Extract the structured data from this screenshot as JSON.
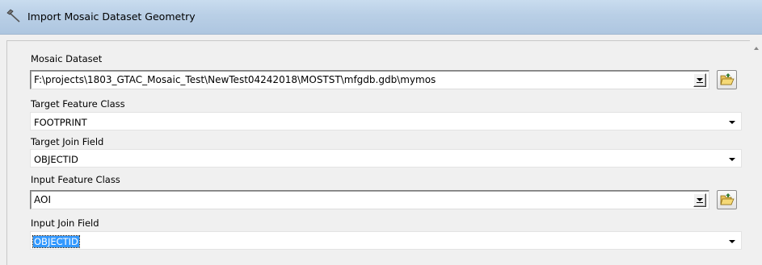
{
  "window": {
    "title": "Import Mosaic Dataset Geometry",
    "icon": "hammer-icon"
  },
  "form": {
    "mosaic_dataset": {
      "label": "Mosaic Dataset",
      "value": "F:\\projects\\1803_GTAC_Mosaic_Test\\NewTest04242018\\MOSTST\\mfgdb.gdb\\mymos"
    },
    "target_feature_class": {
      "label": "Target Feature Class",
      "value": "FOOTPRINT"
    },
    "target_join_field": {
      "label": "Target Join Field",
      "value": "OBJECTID"
    },
    "input_feature_class": {
      "label": "Input Feature Class",
      "value": "AOI"
    },
    "input_join_field": {
      "label": "Input Join Field",
      "value": "OBJECTID"
    }
  },
  "icons": {
    "browse": "open-folder-icon",
    "dropdown": "chevron-down-icon"
  }
}
